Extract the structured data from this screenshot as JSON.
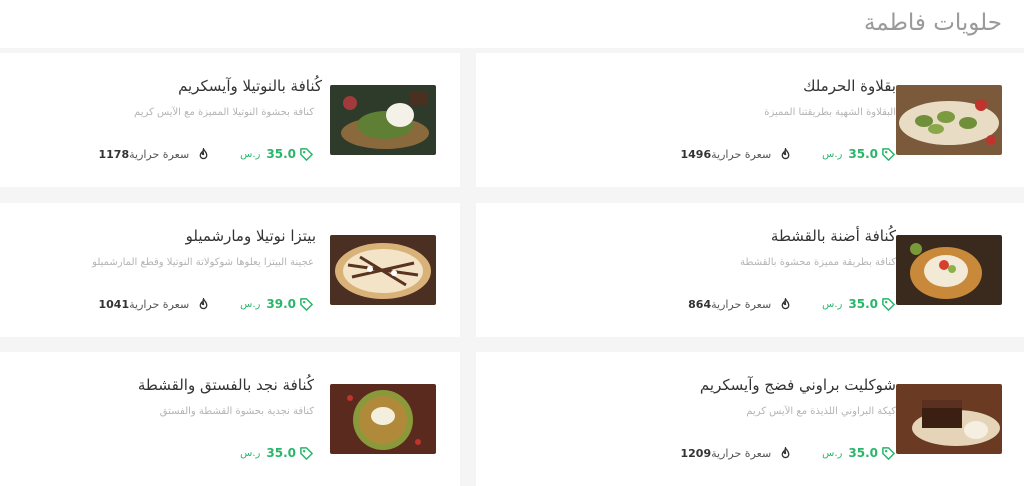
{
  "section": {
    "title": "حلويات فاطمة"
  },
  "currency": "ر.س",
  "calories_label": "سعرة حرارية",
  "colors": {
    "price": "#2ab56a",
    "title": "#9a9a9a"
  },
  "items": [
    {
      "name": "بقلاوة الحرملك",
      "description": "البقلاوة الشهية بطريقتنا المميزة",
      "price": "35.0",
      "calories": "1496"
    },
    {
      "name": "كُنافة بالنوتيلا وآيسكريم",
      "description": "كنافة بحشوة النوتيلا المميزة مع الآيس كريم",
      "price": "35.0",
      "calories": "1178"
    },
    {
      "name": "كُنافة أضنة بالقشطة",
      "description": "كنافة بطريقة مميزة محشوة بالقشطة",
      "price": "35.0",
      "calories": "864"
    },
    {
      "name": "بيتزا نوتيلا ومارشميلو",
      "description": "عجينة البيتزا يعلوها شوكولاتة النوتيلا وقطع المارشميلو",
      "price": "39.0",
      "calories": "1041"
    },
    {
      "name": "شوكليت براوني فضج وآيسكريم",
      "description": "كيكة البراوني اللذيذة مع الآيس كريم",
      "price": "35.0",
      "calories": "1209"
    },
    {
      "name": "كُنافة نجد بالفستق والقشطة",
      "description": "كنافة نجدية بحشوة القشطة والفستق",
      "price": "35.0",
      "calories": ""
    }
  ]
}
